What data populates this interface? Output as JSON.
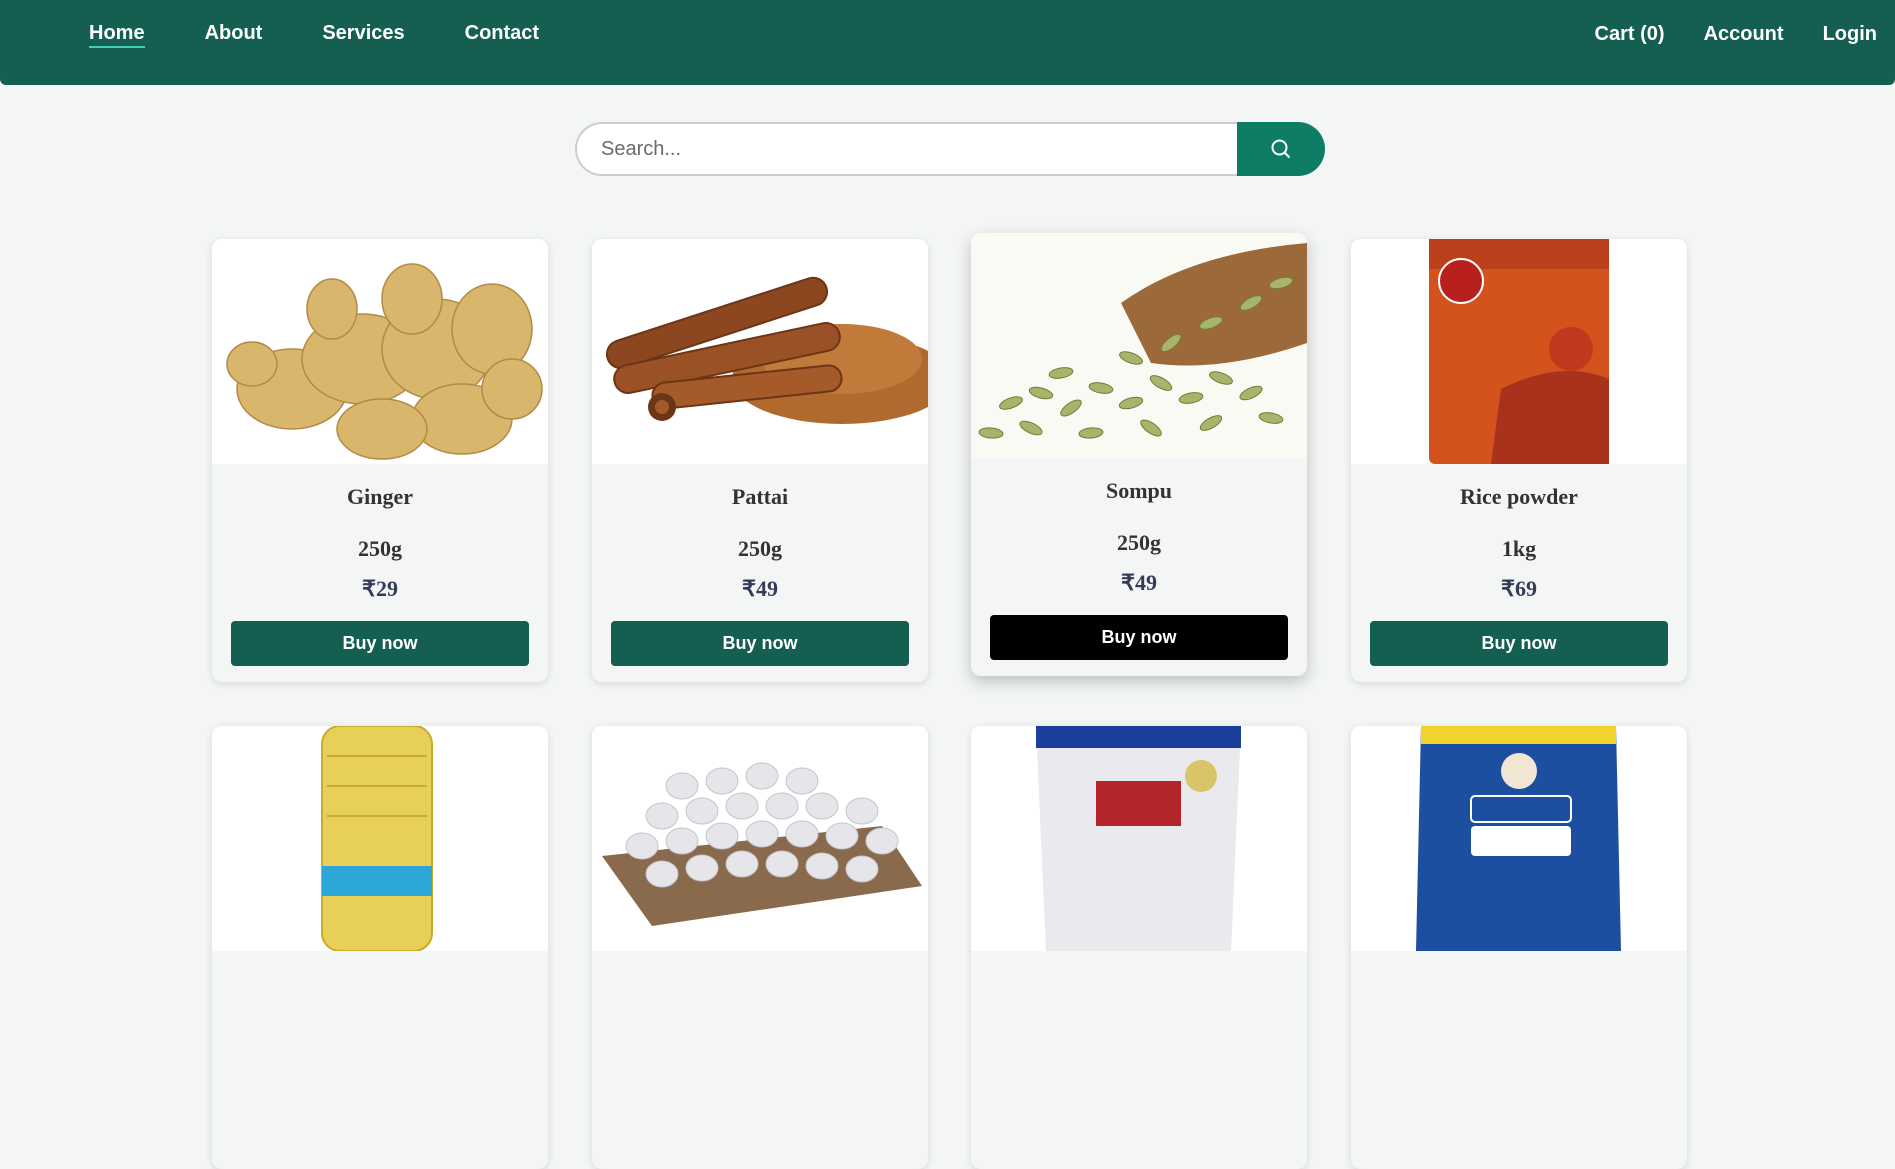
{
  "nav": {
    "left": [
      "Home",
      "About",
      "Services",
      "Contact"
    ],
    "cart": "Cart (0)",
    "account": "Account",
    "login": "Login"
  },
  "search": {
    "placeholder": "Search..."
  },
  "products": [
    {
      "name": "Ginger",
      "qty": "250g",
      "price": "₹29",
      "buy": "Buy now"
    },
    {
      "name": "Pattai",
      "qty": "250g",
      "price": "₹49",
      "buy": "Buy now"
    },
    {
      "name": "Sompu",
      "qty": "250g",
      "price": "₹49",
      "buy": "Buy now"
    },
    {
      "name": "Rice powder",
      "qty": "1kg",
      "price": "₹69",
      "buy": "Buy now"
    }
  ],
  "colors": {
    "nav": "#145f52",
    "button": "#145f52",
    "search_button": "#0f7d66",
    "hover_button": "#000000"
  },
  "icons": [
    "search-icon"
  ]
}
